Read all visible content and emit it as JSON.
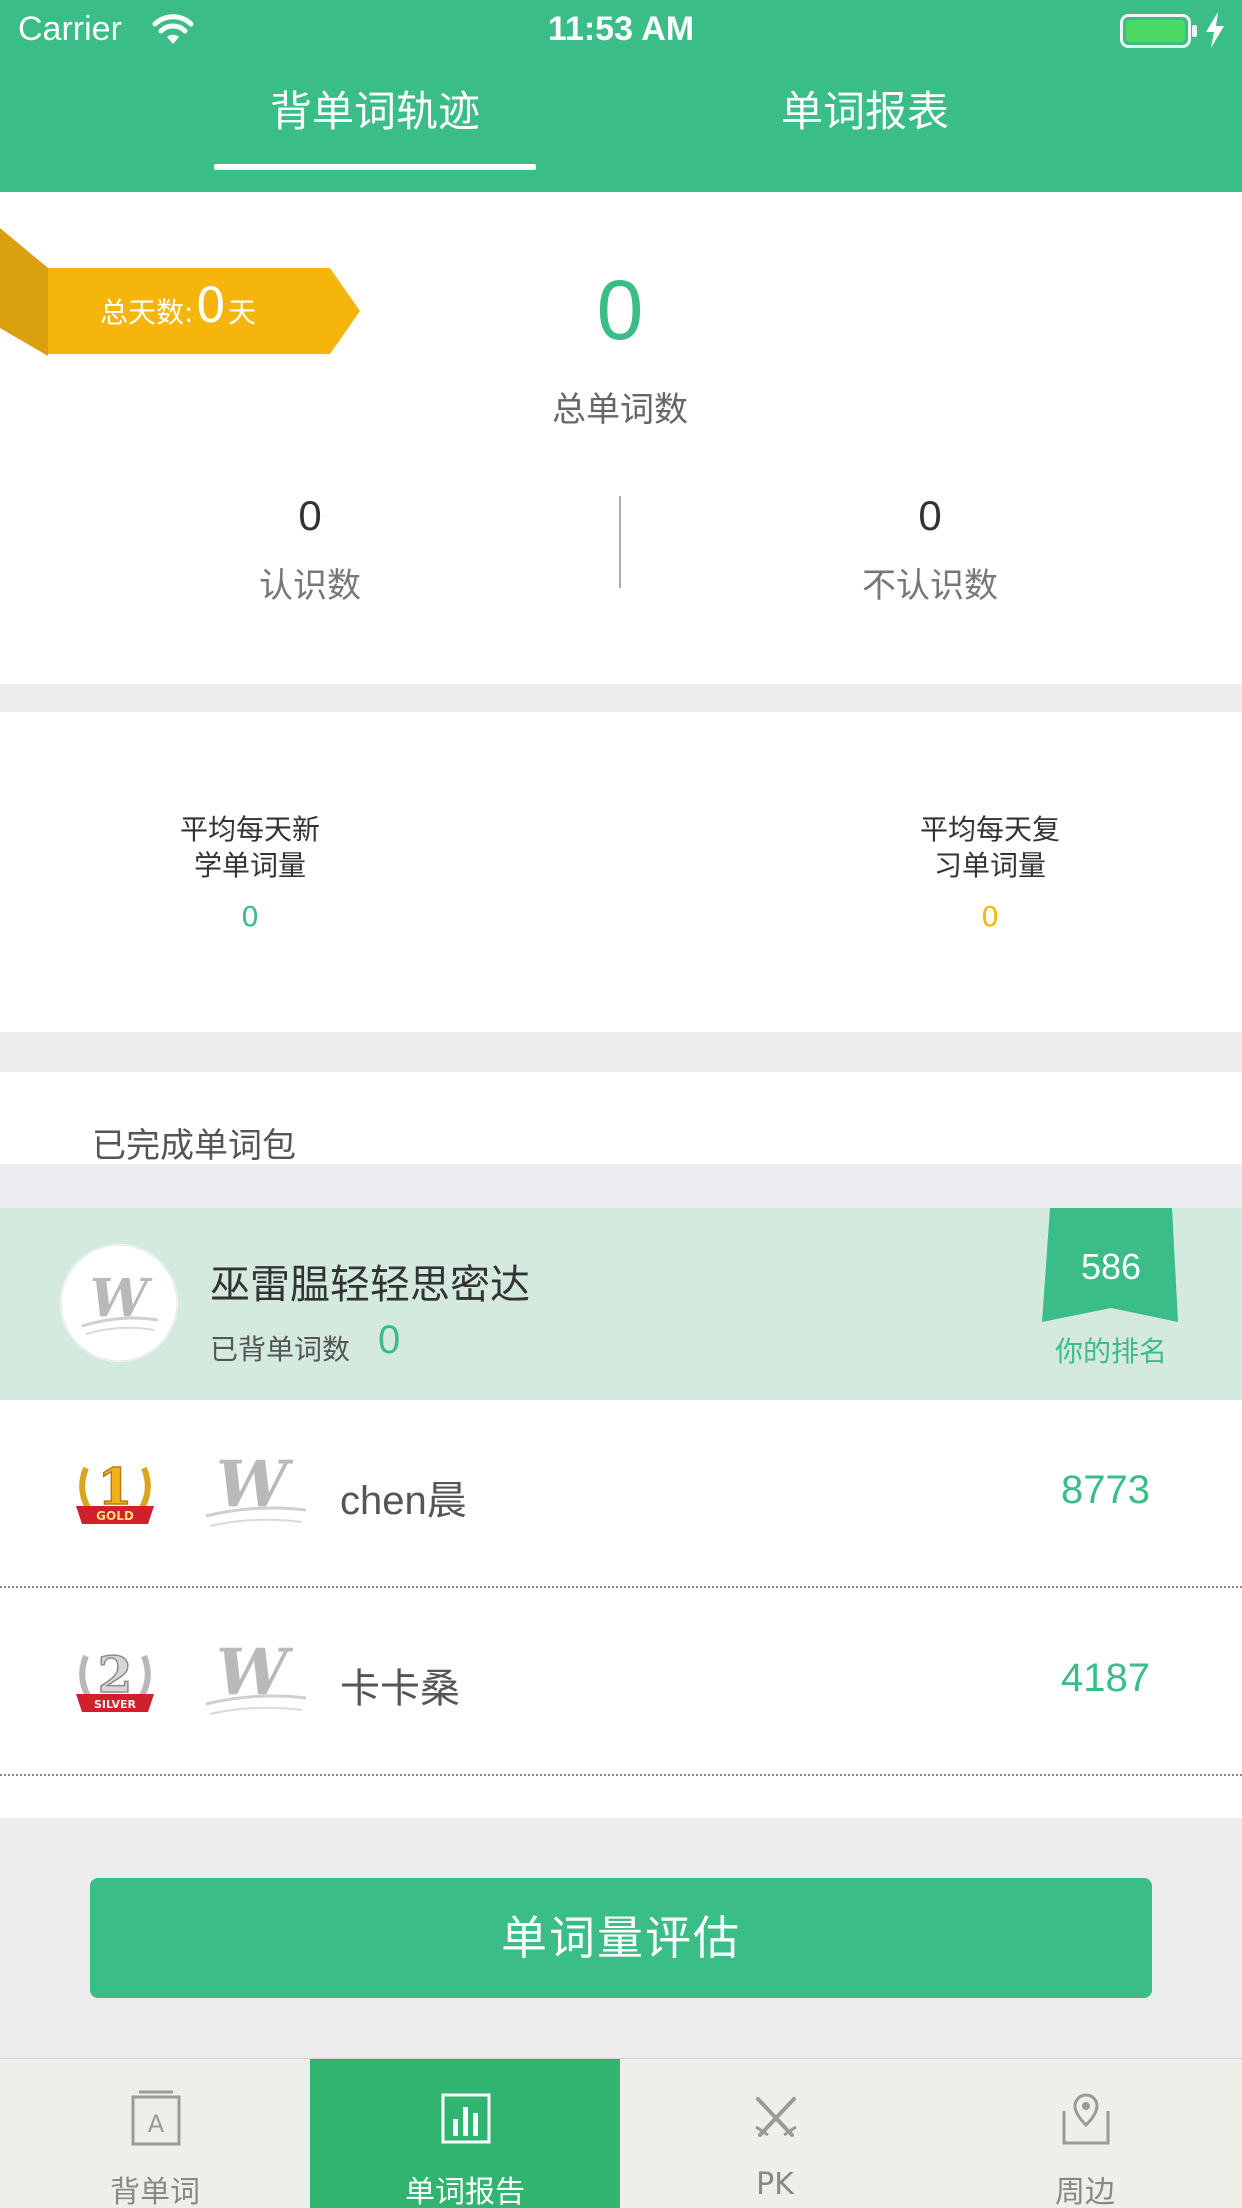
{
  "status_bar": {
    "carrier": "Carrier",
    "time": "11:53 AM"
  },
  "header": {
    "tabs": [
      {
        "label": "背单词轨迹",
        "active": true
      },
      {
        "label": "单词报表",
        "active": false
      }
    ]
  },
  "summary": {
    "days_prefix": "总天数:",
    "days_value": "0",
    "days_suffix": "天",
    "total_words": "0",
    "total_words_label": "总单词数",
    "known": "0",
    "known_label": "认识数",
    "unknown": "0",
    "unknown_label": "不认识数"
  },
  "averages": {
    "new_label": "平均每天新\n学单词量",
    "new_value": "0",
    "review_label": "平均每天复\n习单词量",
    "review_value": "0"
  },
  "packs": {
    "title": "已完成单词包",
    "me": {
      "name": "巫雷腽轻轻思密达",
      "count_label": "已背单词数",
      "count": "0",
      "rank": "586",
      "rank_label": "你的排名"
    },
    "leaderboard": [
      {
        "medal": "gold",
        "medal_text": "GOLD",
        "name": "chen晨",
        "score": "8773"
      },
      {
        "medal": "silver",
        "medal_text": "SILVER",
        "name": "卡卡桑",
        "score": "4187"
      }
    ]
  },
  "assess_button": "单词量评估",
  "tabbar": [
    {
      "label": "背单词",
      "icon": "flashcard-a-icon",
      "active": false
    },
    {
      "label": "单词报告",
      "icon": "bar-chart-icon",
      "active": true
    },
    {
      "label": "PK",
      "icon": "crossed-swords-icon",
      "active": false
    },
    {
      "label": "周边",
      "icon": "map-pin-icon",
      "active": false
    }
  ],
  "colors": {
    "primary": "#3abd86",
    "tab_active": "#32b471",
    "ribbon": "#f5b50a",
    "my_row_bg": "#d4eadf",
    "review_value": "#f5b50a"
  }
}
